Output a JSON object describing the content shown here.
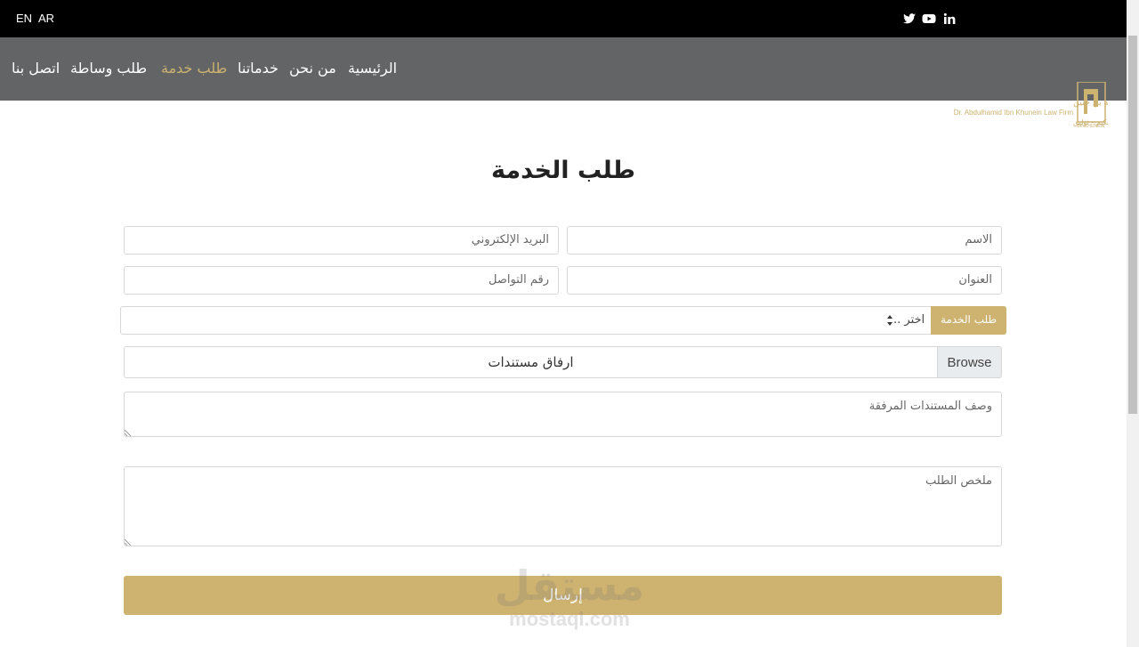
{
  "topbar": {
    "languages": [
      "EN",
      "AR"
    ],
    "social_icons": [
      "twitter-icon",
      "youtube-icon",
      "linkedin-icon"
    ]
  },
  "nav": {
    "items": [
      "اتصل بنا",
      "طلب وساطة",
      "طلب خدمة",
      "خدماتنا",
      "من نحن",
      "الرئيسية"
    ],
    "active": "طلب خدمة"
  },
  "logo": {
    "line1": "مكتب د. عبدالحميد بن راشد بن خنين",
    "line2": "Dr. Abdulhamid Ibn Khunein Law Firm",
    "line3": "استشارات - محاماة - تحكيم - توليق"
  },
  "form": {
    "title": "طلب الخدمة",
    "name_placeholder": "الاسم",
    "email_placeholder": "البريد الإلكتروني",
    "address_placeholder": "العنوان",
    "phone_placeholder": "رقم التواصل",
    "service_label": "طلب الخدمة",
    "service_selected": "اختر ..",
    "file_label": "ارفاق مستندات",
    "browse_label": "Browse",
    "docs_description_placeholder": "وصف المستندات المرفقة",
    "summary_placeholder": "ملخص الطلب",
    "submit_label": "إرسال"
  },
  "watermark": {
    "arabic": "مستقل",
    "latin": "mostaql.com"
  },
  "colors": {
    "accent": "#cdb270",
    "nav_bg": "#636466",
    "topbar_bg": "#000000"
  }
}
